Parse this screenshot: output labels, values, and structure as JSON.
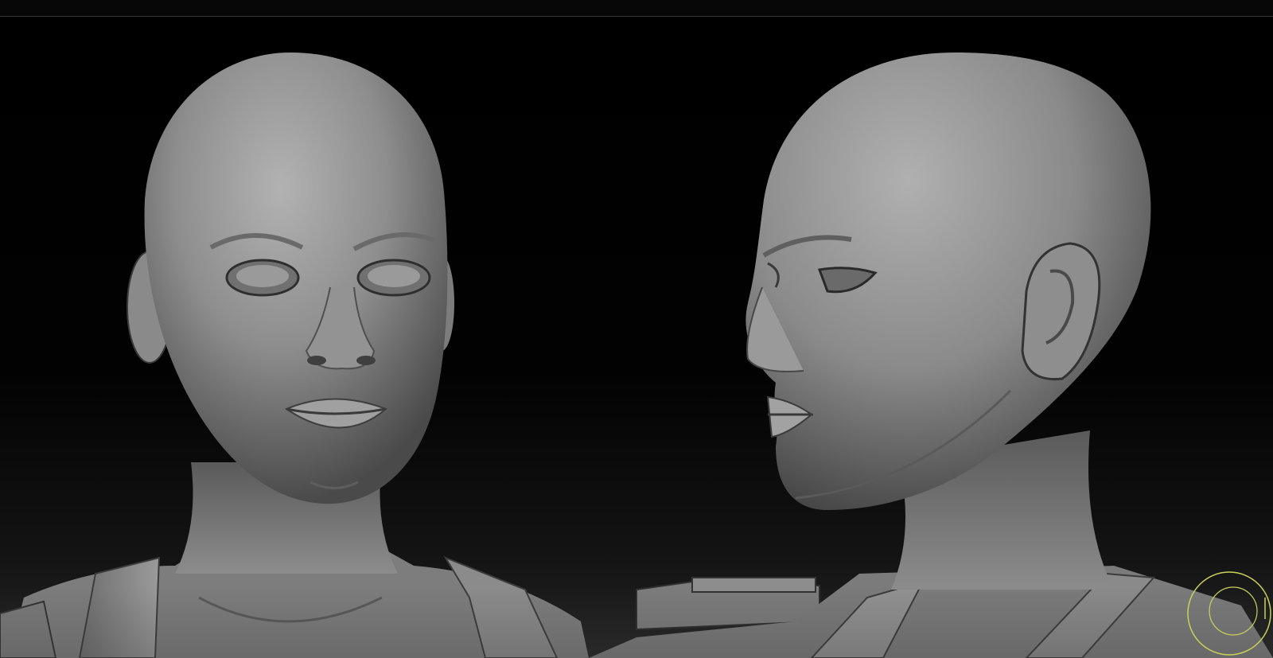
{
  "app": {
    "viewport_background": "#000000",
    "model_color": "#8a8a8a",
    "cursor_color": "#c9d35a",
    "views": [
      "front-view",
      "side-view"
    ]
  },
  "canvas": {
    "cursor_icon": "sculpt-brush-cursor-icon"
  }
}
